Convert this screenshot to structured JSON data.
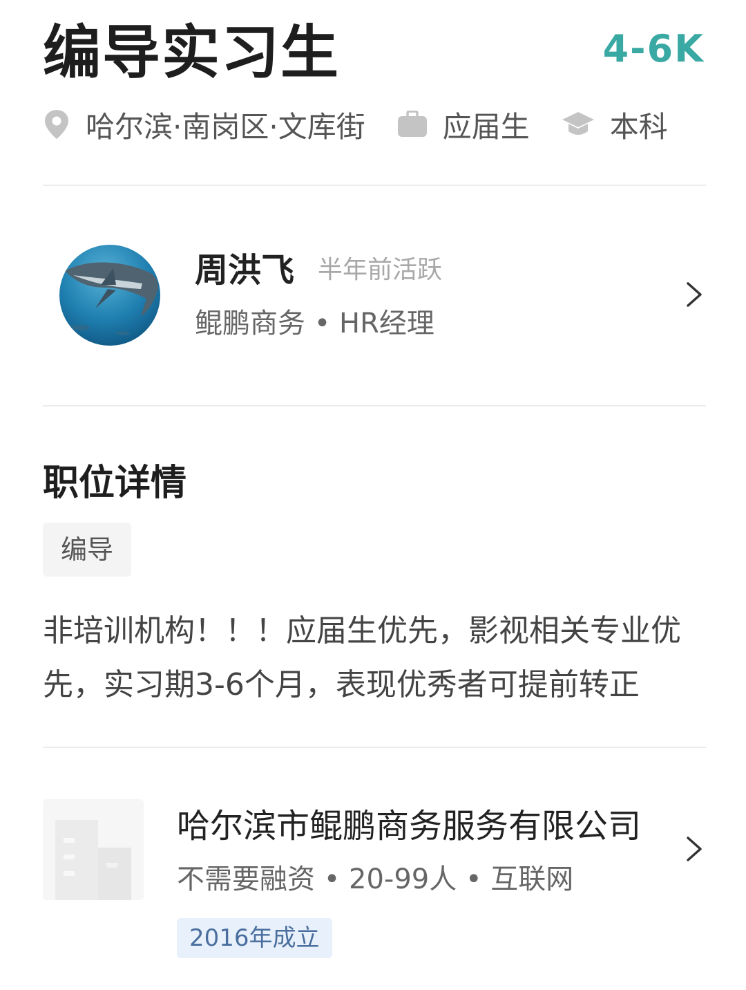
{
  "job": {
    "title": "编导实习生",
    "salary": "4-6K",
    "location": "哈尔滨·南岗区·文库街",
    "experience": "应届生",
    "education": "本科"
  },
  "recruiter": {
    "name": "周洪飞",
    "active_status": "半年前活跃",
    "company_role": "鲲鹏商务 • HR经理"
  },
  "details": {
    "section_title": "职位详情",
    "tag": "编导",
    "description": "非培训机构！！！应届生优先，影视相关专业优先，实习期3-6个月，表现优秀者可提前转正"
  },
  "company": {
    "name": "哈尔滨市鲲鹏商务服务有限公司",
    "meta": "不需要融资 • 20-99人 • 互联网",
    "founded": "2016年成立"
  },
  "icons": {
    "location": "location-pin-icon",
    "experience": "briefcase-icon",
    "education": "graduation-cap-icon",
    "chevron": "chevron-right-icon"
  },
  "colors": {
    "salary": "#3ba9a3",
    "founded_badge_bg": "#e8f0fb"
  }
}
